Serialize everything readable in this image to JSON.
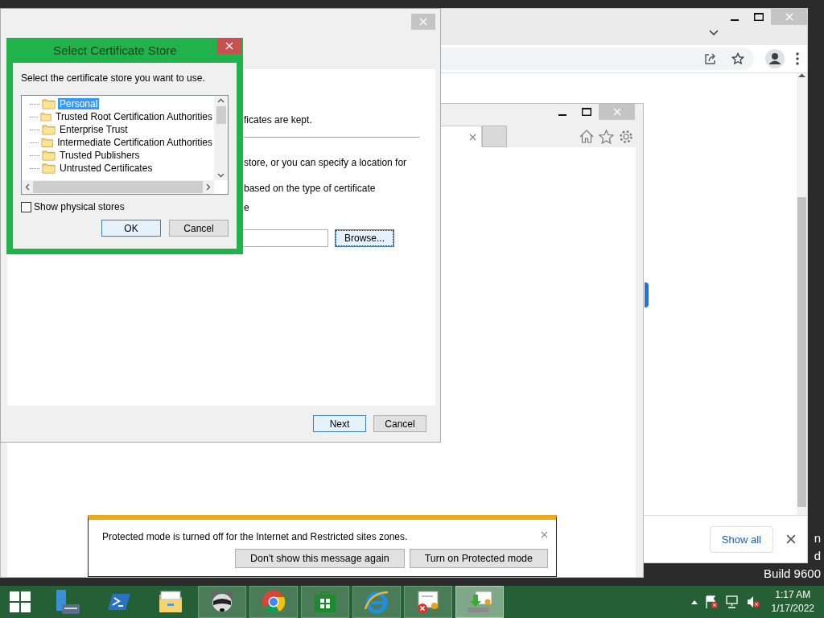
{
  "desktop": {
    "watermark_lines": [
      "n",
      "d",
      "Build 9600"
    ]
  },
  "chrome_window": {
    "download_bar": {
      "show_all": "Show all"
    }
  },
  "ie_window": {
    "notification": {
      "message": "Protected mode is turned off for the Internet and Restricted sites zones.",
      "buttons": [
        "Don't show this message again",
        "Turn on Protected mode"
      ]
    }
  },
  "wizard": {
    "text_fragments": [
      "ficates are kept.",
      "store, or you can specify a location for",
      "based on the type of certificate",
      "e"
    ],
    "browse_button": "Browse...",
    "buttons": [
      "Next",
      "Cancel"
    ]
  },
  "store_dialog": {
    "title": "Select Certificate Store",
    "prompt": "Select the certificate store you want to use.",
    "stores": [
      {
        "label": "Personal",
        "selected": true
      },
      {
        "label": "Trusted Root Certification Authorities",
        "selected": false
      },
      {
        "label": "Enterprise Trust",
        "selected": false
      },
      {
        "label": "Intermediate Certification Authorities",
        "selected": false
      },
      {
        "label": "Trusted Publishers",
        "selected": false
      },
      {
        "label": "Untrusted Certificates",
        "selected": false
      }
    ],
    "show_physical_stores": {
      "label": "Show physical stores",
      "checked": false
    },
    "buttons": [
      "OK",
      "Cancel"
    ]
  },
  "taskbar": {
    "apps": [
      {
        "kind": "server-manager",
        "open": false,
        "selected": false
      },
      {
        "kind": "powershell",
        "open": false,
        "selected": false
      },
      {
        "kind": "file-explorer",
        "open": false,
        "selected": false
      },
      {
        "kind": "raccoon",
        "open": true,
        "selected": false
      },
      {
        "kind": "chrome",
        "open": true,
        "selected": false
      },
      {
        "kind": "store",
        "open": true,
        "selected": false
      },
      {
        "kind": "internet-explorer",
        "open": true,
        "selected": false
      },
      {
        "kind": "certificate-error",
        "open": true,
        "selected": false
      },
      {
        "kind": "certificate-import",
        "open": true,
        "selected": true
      }
    ],
    "clock": {
      "time": "1:17 AM",
      "date": "1/17/2022"
    }
  }
}
